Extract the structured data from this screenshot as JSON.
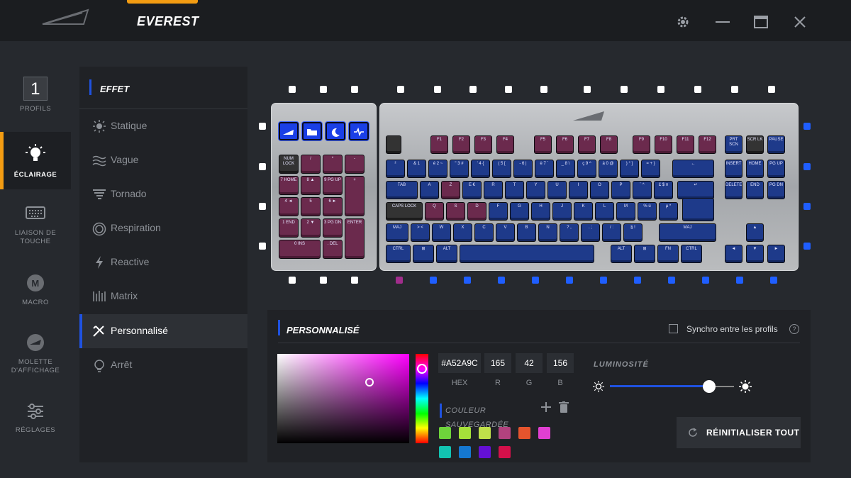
{
  "app": {
    "title": "EVEREST"
  },
  "sidebar": {
    "items": [
      {
        "label": "PROFILS",
        "number": "1",
        "icon": "profile-number-icon"
      },
      {
        "label": "ÉCLAIRAGE",
        "icon": "lightbulb-icon",
        "active": true
      },
      {
        "label": "LIAISON DE TOUCHE",
        "icon": "keyboard-icon"
      },
      {
        "label": "MACRO",
        "icon": "macro-icon"
      },
      {
        "label": "MOLETTE D'AFFICHAGE",
        "icon": "dial-icon"
      },
      {
        "label": "RÉGLAGES",
        "icon": "sliders-icon"
      }
    ]
  },
  "effects": {
    "title": "EFFET",
    "items": [
      {
        "label": "Statique",
        "icon": "sun-icon"
      },
      {
        "label": "Vague",
        "icon": "wave-icon"
      },
      {
        "label": "Tornado",
        "icon": "tornado-icon"
      },
      {
        "label": "Respiration",
        "icon": "breathing-icon"
      },
      {
        "label": "Reactive",
        "icon": "lightning-icon"
      },
      {
        "label": "Matrix",
        "icon": "matrix-icon"
      },
      {
        "label": "Personnalisé",
        "icon": "custom-brush-icon",
        "selected": true
      },
      {
        "label": "Arrêt",
        "icon": "bulb-off-icon"
      }
    ]
  },
  "keyboard": {
    "accent_blue": "#1e3a8a",
    "accent_pink": "#6b2a4d",
    "numpad_media": [
      "logo",
      "folder",
      "moon",
      "pulse"
    ],
    "numpad_keys": [
      "NUM LOCK",
      "/",
      "*",
      "-",
      "7 HOME",
      "8 ▲",
      "9 PG UP",
      "+",
      "4 ◄",
      "5",
      "6 ►",
      "1 END",
      "2 ▼",
      "3 PG DN",
      "ENTER",
      "0 INS",
      ". DEL"
    ],
    "zone_colors_bottom": [
      "pink",
      "blue",
      "blue",
      "blue",
      "blue",
      "blue",
      "blue",
      "blue",
      "blue",
      "blue",
      "blue"
    ]
  },
  "custom": {
    "title": "PERSONNALISÉ",
    "sync_label": "Synchro entre les profils",
    "hex": "#A52A9C",
    "r": "165",
    "g": "42",
    "b": "156",
    "hex_label": "HEX",
    "r_label": "R",
    "g_label": "G",
    "b_label": "B",
    "saved_label": "COULEUR SAUVEGARDÉE",
    "saved_colors": [
      "#6ed33b",
      "#a5e13a",
      "#bfe04a",
      "#b1427e",
      "#e5542d",
      "#e03fd1",
      "#12c3b1",
      "#1578d1",
      "#6410d4",
      "#d4104a"
    ],
    "luminosity_label": "LUMINOSITÉ",
    "luminosity": 0.8,
    "reset_label": "RÉINITIALISER TOUT"
  }
}
